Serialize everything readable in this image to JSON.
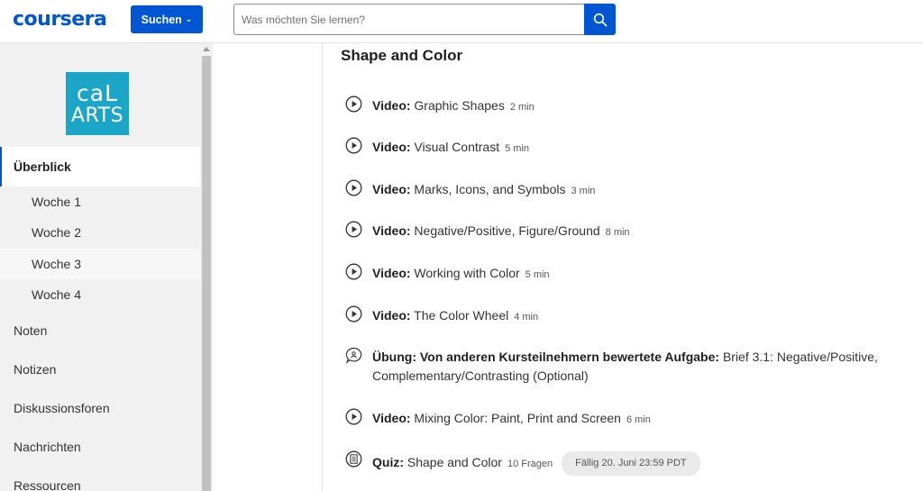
{
  "header": {
    "logo": "coursera",
    "explore_label": "Suchen",
    "search_placeholder": "Was möchten Sie lernen?"
  },
  "colors": {
    "brand": "#0056d2",
    "course_logo_bg": "#1ba6c7",
    "sidebar_bg": "#f1f1f1"
  },
  "sidebar": {
    "course_logo": {
      "line1": "caL",
      "line2": "ARTS"
    },
    "overview": "Überblick",
    "weeks": [
      "Woche 1",
      "Woche 2",
      "Woche 3",
      "Woche 4"
    ],
    "active_week": "Woche 3",
    "links": [
      "Noten",
      "Notizen",
      "Diskussionsforen",
      "Nachrichten",
      "Ressourcen"
    ]
  },
  "content": {
    "section_title": "Shape and Color",
    "items": [
      {
        "icon": "play-circle-icon",
        "type": "Video:",
        "title": "Graphic Shapes",
        "duration": "2 min"
      },
      {
        "icon": "play-circle-icon",
        "type": "Video:",
        "title": "Visual Contrast",
        "duration": "5 min"
      },
      {
        "icon": "play-circle-icon",
        "type": "Video:",
        "title": "Marks, Icons, and Symbols",
        "duration": "3 min"
      },
      {
        "icon": "play-circle-icon",
        "type": "Video:",
        "title": "Negative/Positive, Figure/Ground",
        "duration": "8 min"
      },
      {
        "icon": "play-circle-icon",
        "type": "Video:",
        "title": "Working with Color",
        "duration": "5 min"
      },
      {
        "icon": "play-circle-icon",
        "type": "Video:",
        "title": "The Color Wheel",
        "duration": "4 min"
      },
      {
        "icon": "peer-review-icon",
        "type": "Übung: Von anderen Kursteilnehmern bewertete Aufgabe:",
        "title": "Brief 3.1: Negative/Positive, Complementary/Contrasting (Optional)",
        "duration": ""
      },
      {
        "icon": "play-circle-icon",
        "type": "Video:",
        "title": "Mixing Color: Paint, Print and Screen",
        "duration": "6 min"
      },
      {
        "icon": "quiz-icon",
        "type": "Quiz:",
        "title": "Shape and Color",
        "duration": "10 Fragen",
        "due": "Fällig 20. Juni 23:59 PDT"
      }
    ]
  }
}
